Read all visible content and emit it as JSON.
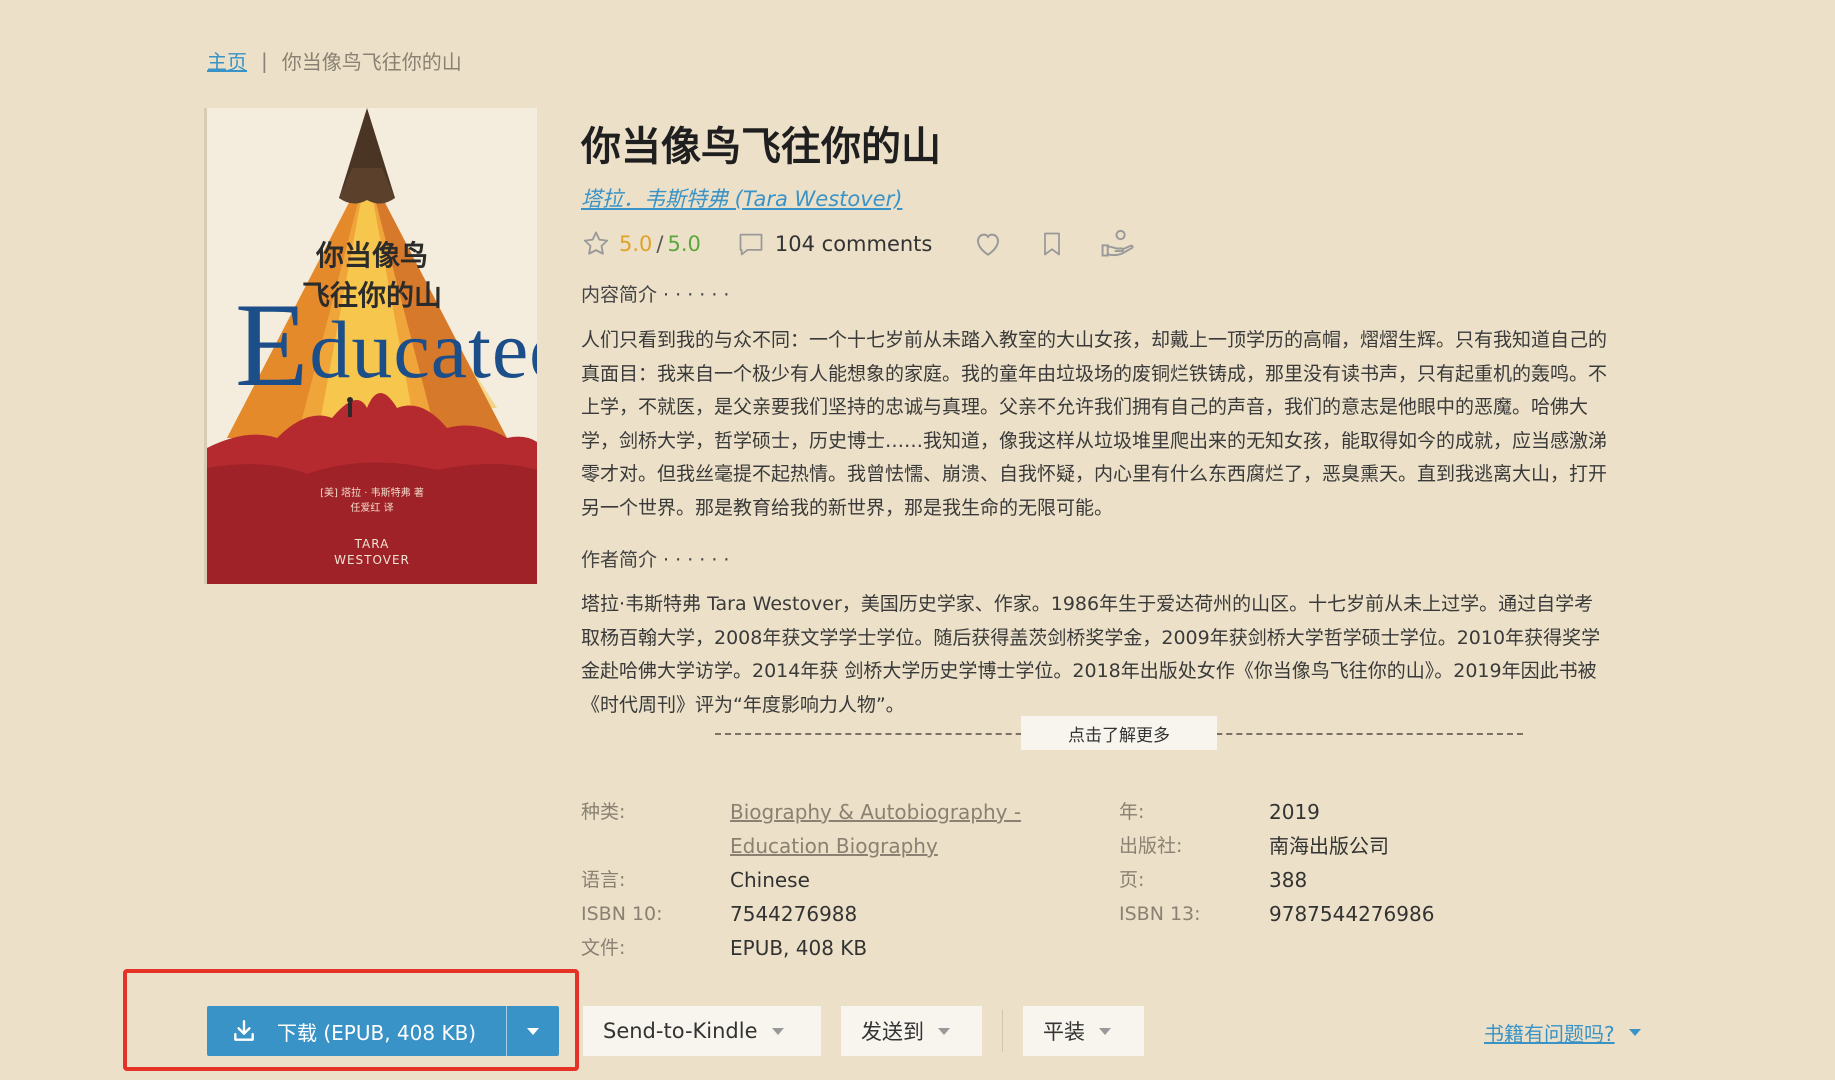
{
  "breadcrumb": {
    "home": "主页",
    "separator": "|",
    "current": "你当像鸟飞往你的山"
  },
  "cover": {
    "title_line1": "你当像鸟",
    "title_line2": "飞往你的山",
    "title_en_initial": "E",
    "title_en_rest": "ducated",
    "author_cn_line1": "[美] 塔拉 · 韦斯特弗 著",
    "author_cn_line2": "任爱红 译",
    "author_en_line1": "TARA",
    "author_en_line2": "WESTOVER"
  },
  "book": {
    "title": "你当像鸟飞往你的山",
    "author": "塔拉．韦斯特弗 (Tara Westover)"
  },
  "rating": {
    "score": "5.0",
    "separator": "/",
    "max": "5.0"
  },
  "comments": {
    "count_label": "104 comments"
  },
  "icons": {
    "star": "star-icon",
    "comment": "comment-icon",
    "favorite": "heart-icon",
    "bookmark": "bookmark-icon",
    "donate": "hand-coin-icon",
    "download": "download-icon"
  },
  "content_intro": {
    "label": "内容简介 · · · · · ·",
    "lines": [
      "人们只看到我的与众不同：一个十七岁前从未踏入教室的大山女孩，却戴上一顶学历的高帽，熠熠生辉。只有我知道自己的",
      "真面目：我来自一个极少有人能想象的家庭。我的童年由垃圾场的废铜烂铁铸成，那里没有读书声，只有起重机的轰鸣。不",
      "上学，不就医，是父亲要我们坚持的忠诚与真理。父亲不允许我们拥有自己的声音，我们的意志是他眼中的恶魔。哈佛大",
      "学，剑桥大学，哲学硕士，历史博士……我知道，像我这样从垃圾堆里爬出来的无知女孩，能取得如今的成就，应当感激涕",
      "零才对。但我丝毫提不起热情。我曾怯懦、崩溃、自我怀疑，内心里有什么东西腐烂了，恶臭熏天。直到我逃离大山，打开",
      "另一个世界。那是教育给我的新世界，那是我生命的无限可能。"
    ]
  },
  "author_intro": {
    "label": "作者简介 · · · · · ·",
    "lines": [
      "塔拉·韦斯特弗 Tara Westover，美国历史学家、作家。1986年生于爱达荷州的山区。十七岁前从未上过学。通过自学考",
      "取杨百翰大学，2008年获文学学士学位。随后获得盖茨剑桥奖学金，2009年获剑桥大学哲学硕士学位。2010年获得奖学",
      "金赴哈佛大学访学。2014年获 剑桥大学历史学博士学位。2018年出版处女作《你当像鸟飞往你的山》。2019年因此书被",
      "《时代周刊》评为“年度影响力人物”。"
    ]
  },
  "more": {
    "label": "点击了解更多"
  },
  "details": {
    "category_label": "种类:",
    "category_line1": "Biography & Autobiography -",
    "category_line2": "Education Biography",
    "year_label": "年:",
    "year": "2019",
    "publisher_label": "出版社:",
    "publisher": "南海出版公司",
    "language_label": "语言:",
    "language": "Chinese",
    "pages_label": "页:",
    "pages": "388",
    "isbn10_label": "ISBN 10:",
    "isbn10": "7544276988",
    "isbn13_label": "ISBN 13:",
    "isbn13": "9787544276986",
    "file_label": "文件:",
    "file": "EPUB, 408 KB"
  },
  "actions": {
    "download": "下载 (EPUB, 408 KB)",
    "send_to_kindle": "Send-to-Kindle",
    "send_to": "发送到",
    "format": "平装",
    "report": "书籍有问题吗?"
  },
  "colors": {
    "background": "#ece1c8",
    "accent": "#3a93c6",
    "rating": "#e0a22a",
    "rating_max": "#5aa83a",
    "highlight": "#e53228"
  }
}
